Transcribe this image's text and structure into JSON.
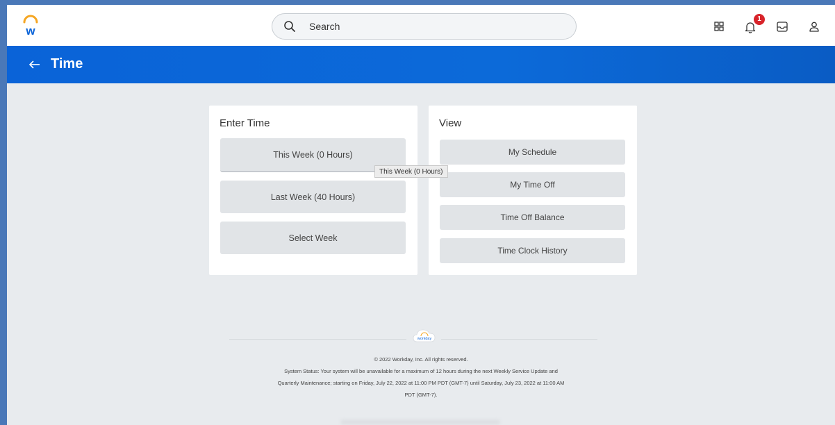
{
  "search": {
    "placeholder": "Search"
  },
  "notifications": {
    "count": "1"
  },
  "header": {
    "title": "Time"
  },
  "enter_time": {
    "title": "Enter Time",
    "buttons": [
      "This Week (0 Hours)",
      "Last Week (40 Hours)",
      "Select Week"
    ]
  },
  "view": {
    "title": "View",
    "buttons": [
      "My Schedule",
      "My Time Off",
      "Time Off Balance",
      "Time Clock History"
    ]
  },
  "tooltip": "This Week (0 Hours)",
  "footer": {
    "logo_text": "workday",
    "copyright": "© 2022 Workday, Inc. All rights reserved.",
    "status_line1": "System Status: Your system will be unavailable for a maximum of 12 hours during the next Weekly Service Update and",
    "status_line2": "Quarterly Maintenance; starting on Friday, July 22, 2022 at 11:00 PM PDT (GMT-7) until Saturday, July 23, 2022 at 11:00 AM",
    "status_line3": "PDT (GMT-7)."
  },
  "colors": {
    "header_blue": "#0a63d8",
    "badge_red": "#d8242a",
    "logo_orange": "#f5a623",
    "logo_blue": "#0a63d8"
  }
}
